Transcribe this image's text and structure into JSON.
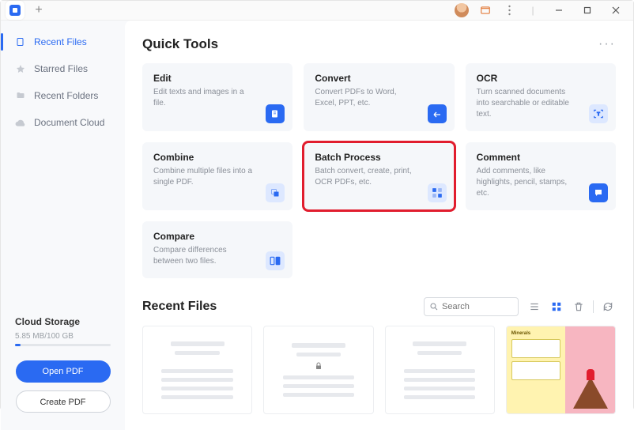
{
  "titlebar": {
    "add_tab": "+"
  },
  "sidebar": {
    "items": [
      {
        "label": "Recent Files"
      },
      {
        "label": "Starred Files"
      },
      {
        "label": "Recent Folders"
      },
      {
        "label": "Document Cloud"
      }
    ]
  },
  "cloud_storage": {
    "title": "Cloud Storage",
    "usage": "5.85 MB/100 GB"
  },
  "buttons": {
    "open_pdf": "Open PDF",
    "create_pdf": "Create PDF"
  },
  "quick_tools": {
    "title": "Quick Tools",
    "cards": [
      {
        "title": "Edit",
        "desc": "Edit texts and images in a file."
      },
      {
        "title": "Convert",
        "desc": "Convert PDFs to Word, Excel, PPT, etc."
      },
      {
        "title": "OCR",
        "desc": "Turn scanned documents into searchable or editable text."
      },
      {
        "title": "Combine",
        "desc": "Combine multiple files into a single PDF."
      },
      {
        "title": "Batch Process",
        "desc": "Batch convert, create, print, OCR PDFs, etc."
      },
      {
        "title": "Comment",
        "desc": "Add comments, like highlights, pencil, stamps, etc."
      },
      {
        "title": "Compare",
        "desc": "Compare differences between two files."
      }
    ]
  },
  "recent_files": {
    "title": "Recent Files",
    "search_placeholder": "Search",
    "thumb_label": "Minerals"
  }
}
